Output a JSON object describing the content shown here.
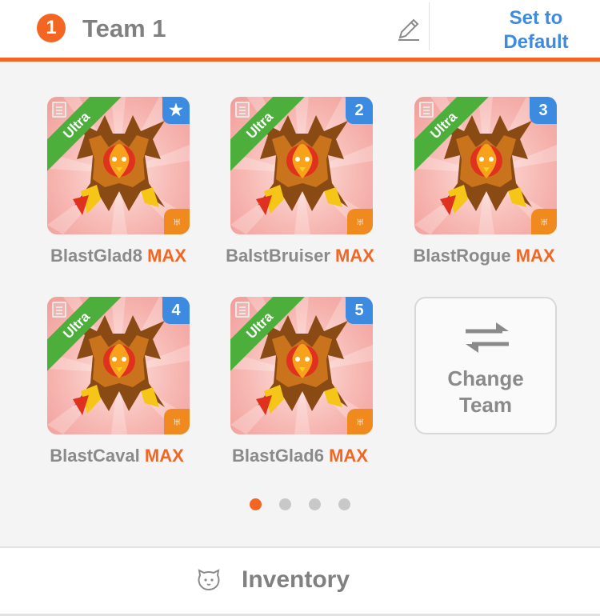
{
  "header": {
    "team_number": "1",
    "team_name": "Team 1",
    "set_default_line1": "Set to",
    "set_default_line2": "Default"
  },
  "team": [
    {
      "rarity": "Ultra",
      "rank": "★",
      "element": "♅",
      "name": "BlastGlad8",
      "level": "MAX"
    },
    {
      "rarity": "Ultra",
      "rank": "2",
      "element": "♅",
      "name": "BalstBruiser",
      "level": "MAX"
    },
    {
      "rarity": "Ultra",
      "rank": "3",
      "element": "♅",
      "name": "BlastRogue",
      "level": "MAX"
    },
    {
      "rarity": "Ultra",
      "rank": "4",
      "element": "♅",
      "name": "BlastCaval",
      "level": "MAX"
    },
    {
      "rarity": "Ultra",
      "rank": "5",
      "element": "♅",
      "name": "BlastGlad6",
      "level": "MAX"
    }
  ],
  "change_team": {
    "line1": "Change",
    "line2": "Team"
  },
  "pager": {
    "pages": 4,
    "active": 1
  },
  "footer": {
    "inventory_label": "Inventory"
  },
  "colors": {
    "accent": "#f26522",
    "link": "#3d8be0",
    "ultra": "#4caf3c",
    "element": "#f08a1e"
  }
}
